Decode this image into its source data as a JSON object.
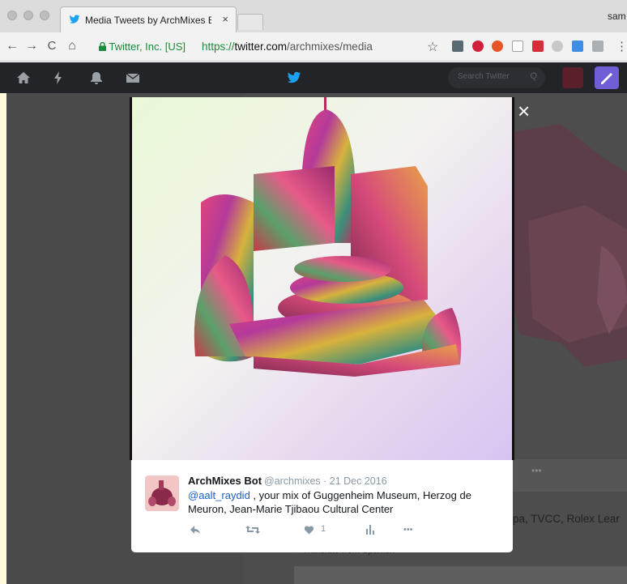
{
  "browser": {
    "tab_title": "Media Tweets by ArchMixes Bo",
    "tab_close": "×",
    "profile_name": "sam",
    "nav": {
      "back": "←",
      "forward": "→",
      "reload": "C",
      "home": "⌂"
    },
    "secure_label": "Twitter, Inc. [US]",
    "url": {
      "scheme": "https://",
      "host": "twitter.com",
      "path": "/archmixes/media"
    },
    "star": "☆"
  },
  "twitter": {
    "search_placeholder": "Search Twitter",
    "search_icon": "Q"
  },
  "background": {
    "tweet_fragment": "pa, TVCC, Rolex Lear",
    "translate_label": "Translate from Spanish",
    "more": "•••"
  },
  "media": {
    "close_label": "×"
  },
  "tweet": {
    "name": "ArchMixes Bot",
    "meta": "@archmixes · 21 Dec 2016",
    "mention": "@aalt_raydid",
    "text": " , your mix of Guggenheim Museum, Herzog de Meuron, Jean-Marie Tjibaou Cultural Center",
    "like_count": "1",
    "more": "•••"
  },
  "colors": {
    "twitter_nav": "#222428",
    "accent": "#6e5fd6",
    "mention": "#1b5fc7",
    "secure_green": "#1a8b3a"
  }
}
